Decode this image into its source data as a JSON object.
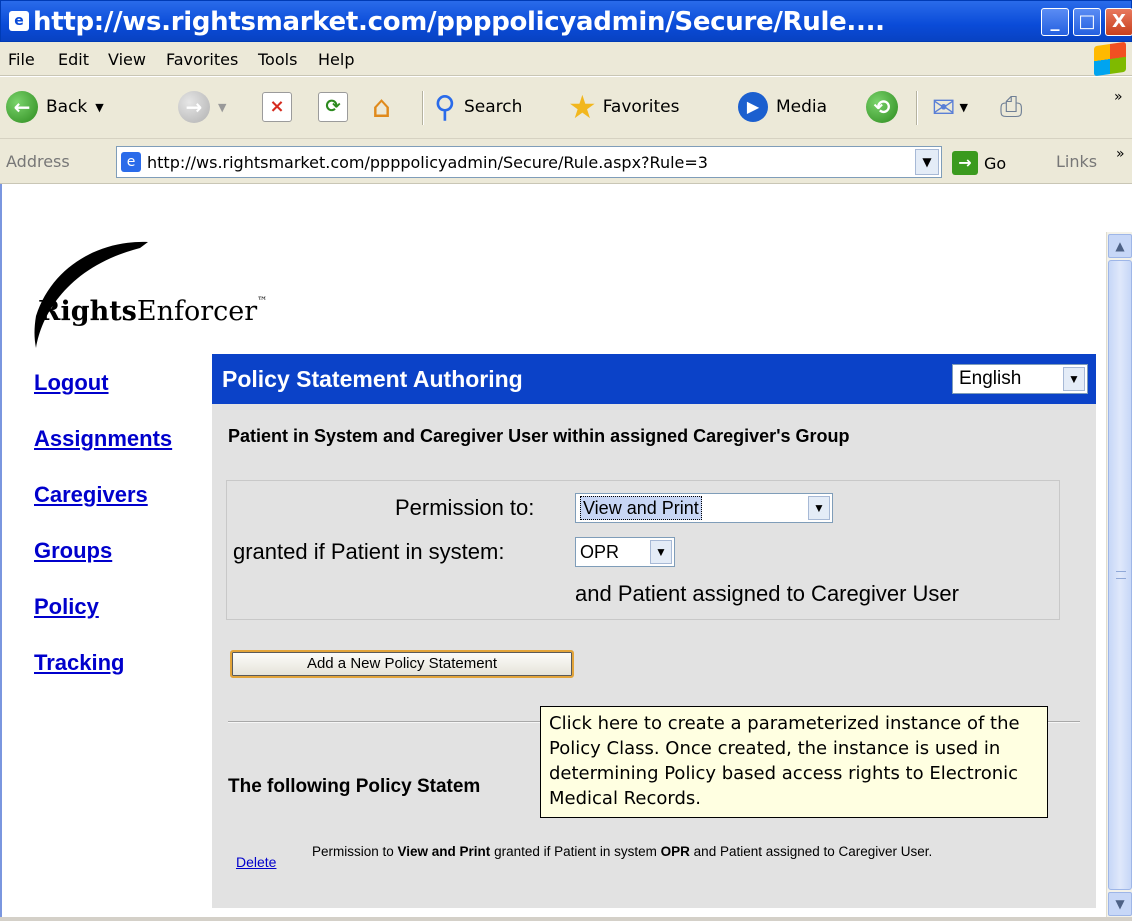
{
  "window": {
    "title": "http://ws.rightsmarket.com/ppppolicyadmin/Secure/Rule....",
    "min_label": "_",
    "max_label": "□",
    "close_label": "X"
  },
  "menu": [
    "File",
    "Edit",
    "View",
    "Favorites",
    "Tools",
    "Help"
  ],
  "toolbar": {
    "back": "Back",
    "search": "Search",
    "favorites": "Favorites",
    "media": "Media"
  },
  "address": {
    "label": "Address",
    "url": "http://ws.rightsmarket.com/ppppolicyadmin/Secure/Rule.aspx?Rule=3",
    "go": "Go",
    "links": "Links"
  },
  "logo": {
    "bold": "Rights",
    "rest": "Enforcer",
    "tm": "™"
  },
  "nav": [
    "Logout",
    "Assignments",
    "Caregivers",
    "Groups",
    "Policy",
    "Tracking"
  ],
  "panel": {
    "title": "Policy Statement Authoring",
    "language": "English",
    "subtitle": "Patient in System and Caregiver User within assigned Caregiver's Group",
    "permission_label": "Permission to:",
    "permission_value": "View and Print",
    "granted_label": "granted if Patient in system:",
    "system_value": "OPR",
    "assigned_text": "and Patient assigned to Caregiver User",
    "add_button": "Add a New Policy Statement",
    "following": "The following Policy Statem",
    "delete": "Delete",
    "statement": {
      "p1": "Permission to ",
      "b1": "View and Print",
      "p2": " granted if Patient in system ",
      "b2": "OPR",
      "p3": " and Patient assigned to Caregiver User."
    }
  },
  "tooltip": "Click here to create a parameterized instance of the Policy Class.  Once created, the instance is used in determining Policy based access rights to Electronic Medical Records."
}
